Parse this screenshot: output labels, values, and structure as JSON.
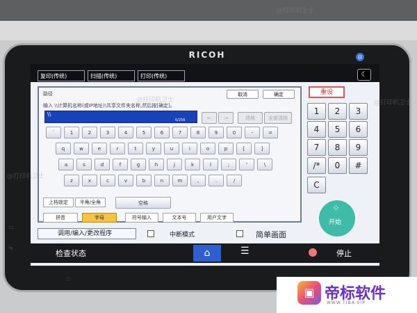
{
  "device": {
    "brand": "RICOH"
  },
  "function_tabs": [
    "复印(传统)",
    "扫描(传统)",
    "打印(传统)"
  ],
  "dialog": {
    "title": "路径",
    "cancel_label": "取消",
    "ok_label": "确定",
    "hint": "输入 \\\\计算机名称(或IP地址)\\共享文件夹名称,然后按[确定]。",
    "input_value": "\\\\",
    "input_counter": "0/256",
    "nav_keys": [
      "←",
      "→",
      "退格",
      "全部清除"
    ],
    "keyboard_rows": [
      [
        "`",
        "1",
        "2",
        "3",
        "4",
        "5",
        "6",
        "7",
        "8",
        "9",
        "0",
        "-",
        "="
      ],
      [
        "q",
        "w",
        "e",
        "r",
        "t",
        "y",
        "u",
        "i",
        "o",
        "p",
        "[",
        "]"
      ],
      [
        "a",
        "s",
        "d",
        "f",
        "g",
        "h",
        "j",
        "k",
        "l",
        ";",
        "'",
        "\\"
      ],
      [
        "z",
        "x",
        "c",
        "v",
        "b",
        "n",
        "m",
        ",",
        ".",
        "/"
      ]
    ],
    "shift_lock_label": "上档锁定",
    "half_full_label": "半角/全角",
    "space_label": "空格",
    "pinyin_label": "拼音",
    "letters_label": "字母",
    "symbol_label": "符号输入",
    "text_label": "文本号",
    "user_text_label": "用户文字"
  },
  "keypad": {
    "reset_label": "重设",
    "keys": [
      "1",
      "2",
      "3",
      "4",
      "5",
      "6",
      "7",
      "8",
      "9",
      "/*",
      "0",
      "#",
      "C"
    ],
    "start_icon": "◇",
    "start_label": "开始"
  },
  "bottom": {
    "program_label": "调用/编入/更改程序",
    "interrupt_label": "中断模式",
    "simple_label": "简单画面",
    "status_label": "检查状态",
    "home_icon": "⌂",
    "menu_icon": "☰",
    "stop_label": "停止"
  },
  "watermark": {
    "text": "@打印机卫士",
    "brand_name": "帝标软件",
    "brand_url": "WWW.TIBA.VIP"
  }
}
